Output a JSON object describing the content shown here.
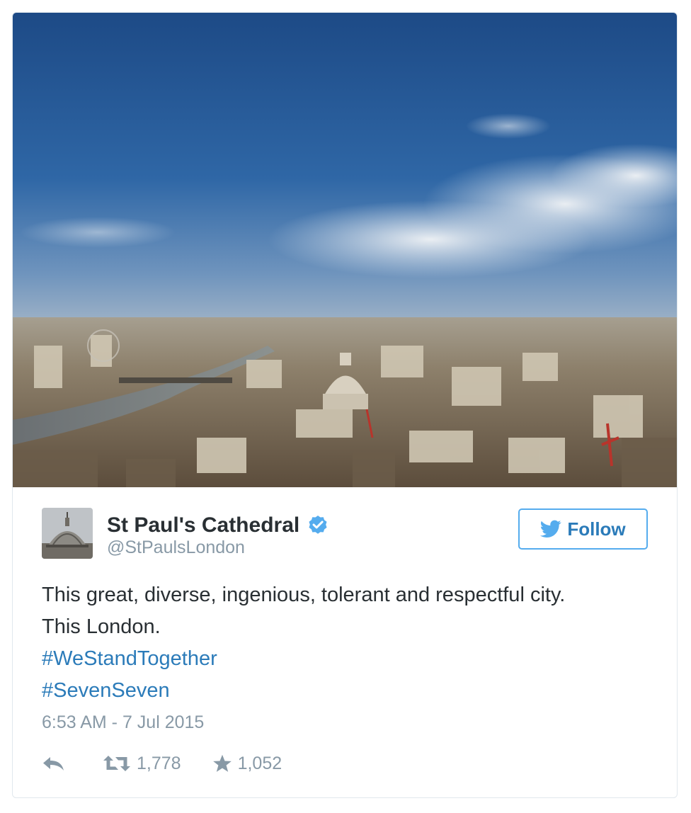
{
  "user": {
    "name": "St Paul's Cathedral",
    "handle": "@StPaulsLondon",
    "verified": true
  },
  "follow_button": {
    "label": "Follow",
    "icon": "twitter-bird-icon"
  },
  "tweet": {
    "lines": [
      "This great, diverse, ingenious, tolerant and respectful city.",
      "This London."
    ],
    "hashtags": [
      "#WeStandTogether",
      "#SevenSeven"
    ],
    "timestamp": "6:53 AM - 7 Jul 2015"
  },
  "actions": {
    "reply": {
      "icon": "reply-icon"
    },
    "retweet": {
      "icon": "retweet-icon",
      "count": "1,778"
    },
    "favorite": {
      "icon": "star-icon",
      "count": "1,052"
    }
  },
  "colors": {
    "link": "#2b7bb9",
    "follow_border": "#55acee",
    "verified": "#55acee",
    "muted": "#8899a6",
    "text": "#292f33"
  }
}
